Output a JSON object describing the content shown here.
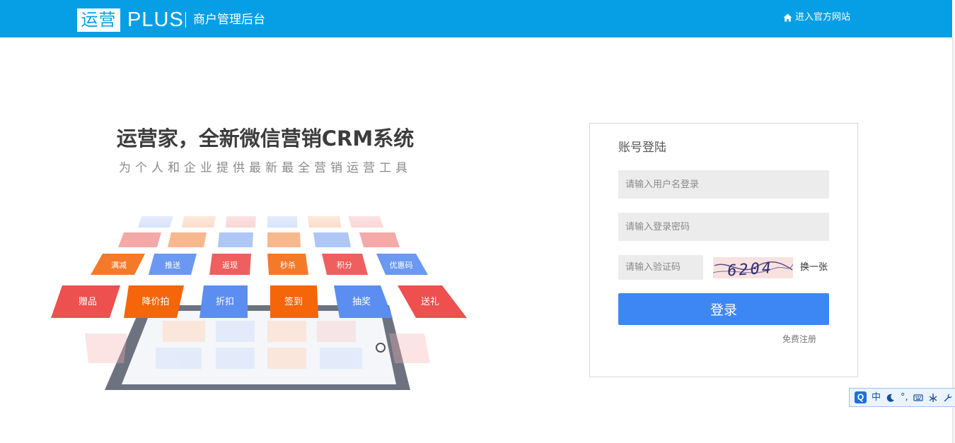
{
  "header": {
    "logo_text": "运营",
    "logo_plus": "PLUS",
    "subtitle": "商户管理后台",
    "site_link": "进入官方网站",
    "site_icon": "home-icon"
  },
  "hero": {
    "title": "运营家，全新微信营销CRM系统",
    "subtitle": "为个人和企业提供最新最全营销运营工具"
  },
  "illustration": {
    "front_tiles": [
      {
        "label": "赠品",
        "color": "#ee4f4f"
      },
      {
        "label": "降价拍",
        "color": "#f5650a"
      },
      {
        "label": "折扣",
        "color": "#5b8ef0"
      },
      {
        "label": "签到",
        "color": "#f5650a"
      },
      {
        "label": "抽奖",
        "color": "#5b8ef0"
      },
      {
        "label": "送礼",
        "color": "#ee4f4f"
      }
    ],
    "second_tiles": [
      {
        "label": "满减",
        "color": "#f47a2a"
      },
      {
        "label": "推送",
        "color": "#6b98f1"
      },
      {
        "label": "返现",
        "color": "#ef5f5f"
      },
      {
        "label": "秒杀",
        "color": "#f47a2a"
      },
      {
        "label": "积分",
        "color": "#ef5f5f"
      },
      {
        "label": "优惠码",
        "color": "#6b98f1"
      }
    ]
  },
  "login": {
    "title": "账号登陆",
    "username_placeholder": "请输入用户名登录",
    "password_placeholder": "请输入登录密码",
    "captcha_placeholder": "请输入验证码",
    "captcha_value": "6204",
    "refresh_label": "换一张",
    "submit_label": "登录",
    "register_label": "免费注册"
  },
  "ime_toolbar": {
    "logo": "Q",
    "mode": "中",
    "punct": "°,"
  },
  "colors": {
    "brand": "#069fe6",
    "button": "#3d87f5",
    "input_bg": "#ececec"
  }
}
